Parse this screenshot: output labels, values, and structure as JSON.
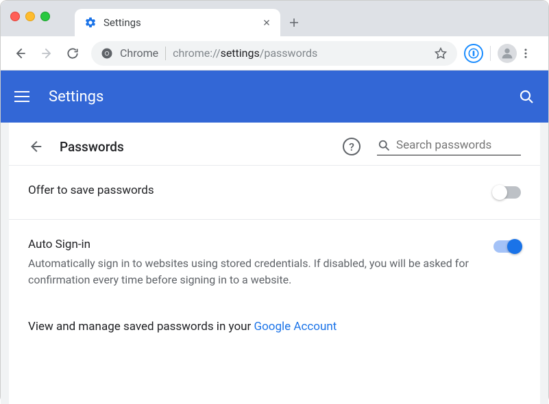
{
  "window": {
    "tab_title": "Settings",
    "url_scheme_label": "Chrome",
    "url_prefix": "chrome://",
    "url_bold": "settings",
    "url_suffix": "/passwords"
  },
  "appbar": {
    "title": "Settings"
  },
  "page": {
    "title": "Passwords",
    "search_placeholder": "Search passwords"
  },
  "settings": {
    "offer_save": {
      "label": "Offer to save passwords",
      "enabled": false
    },
    "auto_signin": {
      "label": "Auto Sign-in",
      "desc": "Automatically sign in to websites using stored credentials. If disabled, you will be asked for confirmation every time before signing in to a website.",
      "enabled": true
    },
    "manage": {
      "prefix": "View and manage saved passwords in your ",
      "link_text": "Google Account"
    }
  }
}
